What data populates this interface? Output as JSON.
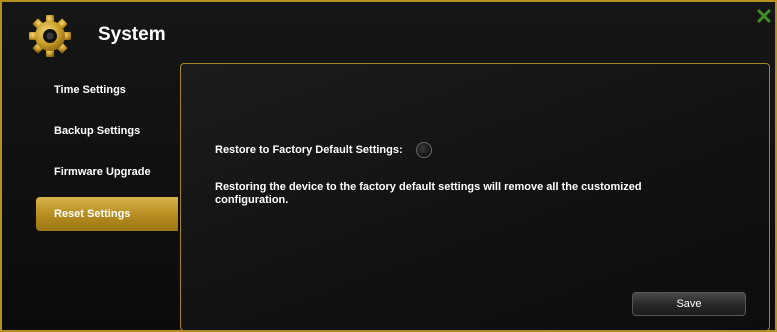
{
  "header": {
    "title": "System",
    "icon": "gear-icon",
    "close_icon": "close-icon"
  },
  "sidebar": {
    "items": [
      {
        "label": "Time Settings",
        "active": false
      },
      {
        "label": "Backup Settings",
        "active": false
      },
      {
        "label": "Firmware Upgrade",
        "active": false
      },
      {
        "label": "Reset Settings",
        "active": true
      }
    ]
  },
  "main": {
    "restore_label": "Restore to Factory Default Settings:",
    "description": "Restoring the device to the factory default settings will remove all the customized configuration.",
    "save_label": "Save"
  },
  "colors": {
    "accent": "#c9a233",
    "close": "#3f8a2a",
    "background": "#0d0d0d"
  }
}
